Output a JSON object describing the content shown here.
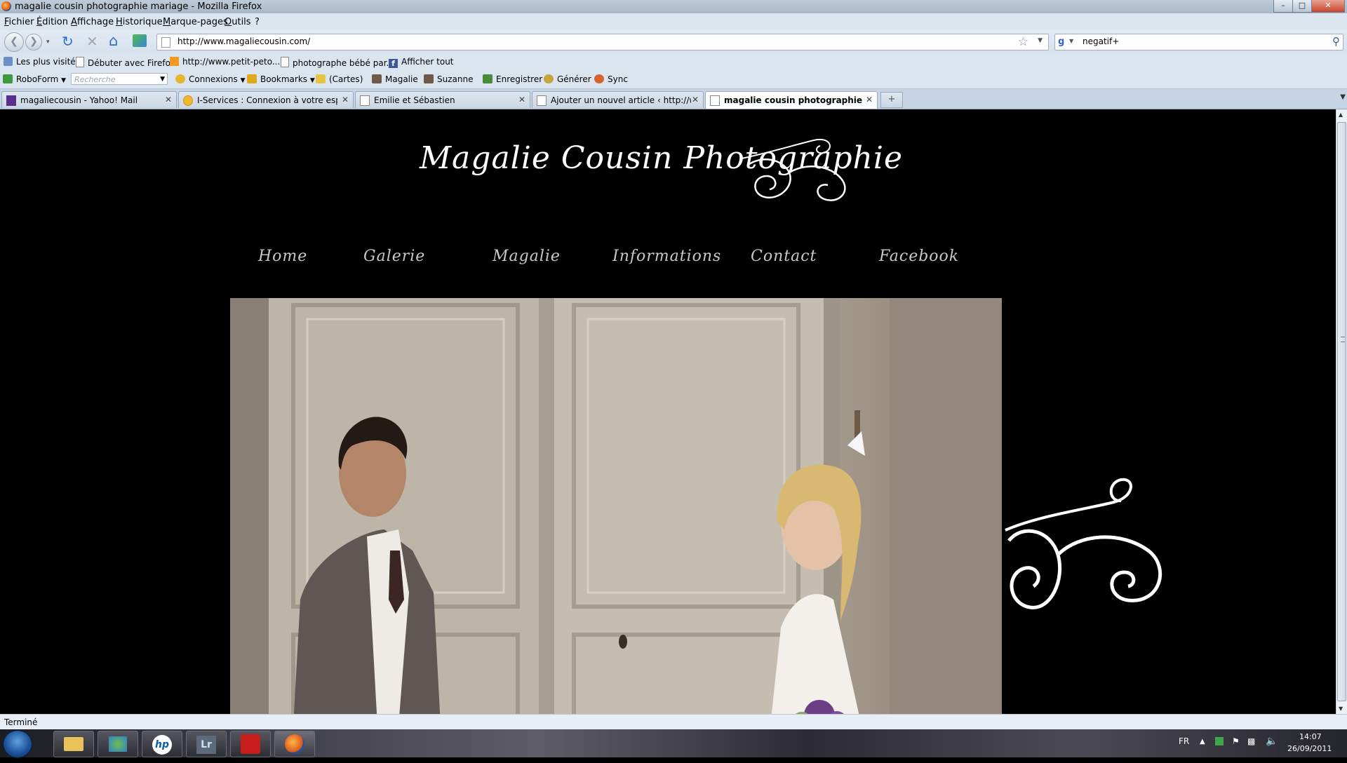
{
  "window": {
    "title": "magalie cousin photographie mariage - Mozilla Firefox"
  },
  "menu": [
    "Fichier",
    "Édition",
    "Affichage",
    "Historique",
    "Marque-pages",
    "Outils",
    "?"
  ],
  "nav": {
    "url": "http://www.magaliecousin.com/",
    "search_value": "negatif+"
  },
  "bookmarks": [
    "Les plus visités",
    "Débuter avec Firefox",
    "http://www.petit-peto...",
    "photographe bébé par...",
    "Afficher tout"
  ],
  "roboform": {
    "label": "RoboForm",
    "search_placeholder": "Recherche",
    "items": [
      "Connexions",
      "Bookmarks",
      "(Cartes)",
      "Magalie",
      "Suzanne",
      "Enregistrer",
      "Générer",
      "Sync"
    ]
  },
  "tabs": [
    {
      "label": "magaliecousin - Yahoo! Mail",
      "active": false
    },
    {
      "label": "I-Services : Connexion à votre espac...",
      "active": false
    },
    {
      "label": "Emilie et Sébastien",
      "active": false
    },
    {
      "label": "Ajouter un nouvel article ‹ http://w...",
      "active": false
    },
    {
      "label": "magalie cousin photographie mari...",
      "active": true
    }
  ],
  "site": {
    "logo_text": "Magalie Cousin Photographie",
    "nav": [
      "Home",
      "Galerie",
      "Magalie",
      "Informations",
      "Contact",
      "Facebook"
    ]
  },
  "status": {
    "text": "Terminé"
  },
  "tray": {
    "lang": "FR",
    "time": "14:07",
    "date": "26/09/2011"
  },
  "taskbar": {
    "apps": [
      "explorer-icon",
      "people-icon",
      "hp-icon",
      "lightroom-icon",
      "acrobat-icon",
      "firefox-icon"
    ],
    "lightroom_label": "Lr",
    "hp_label": "hp"
  }
}
